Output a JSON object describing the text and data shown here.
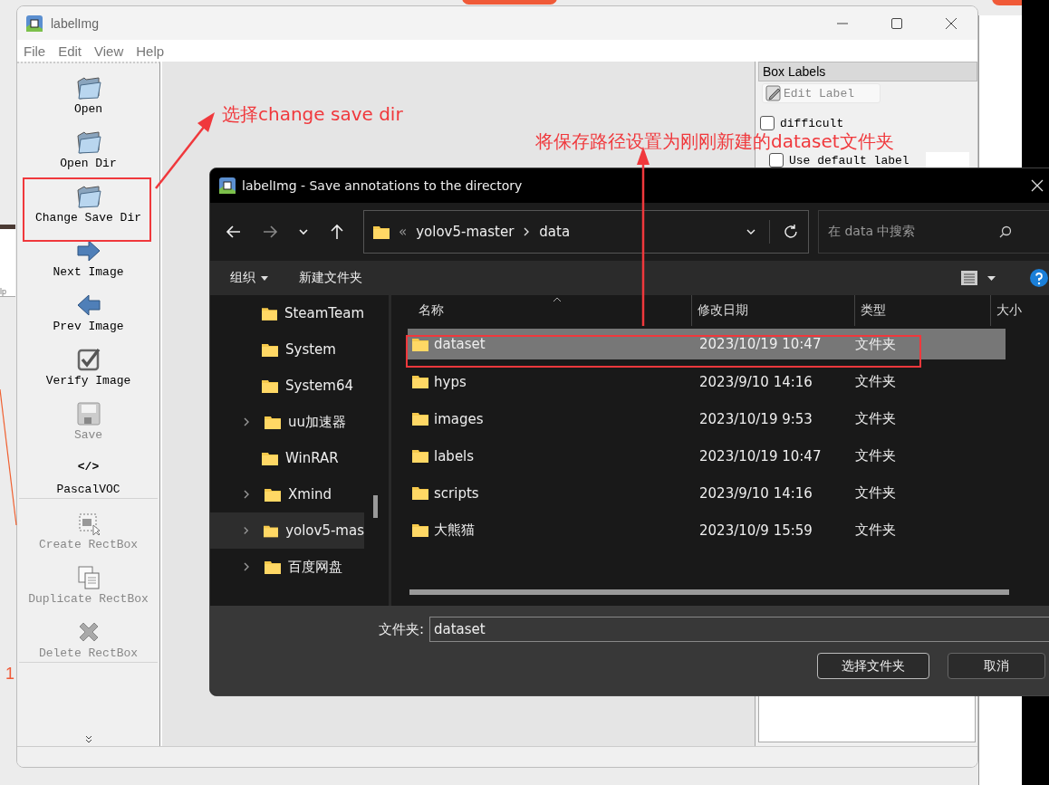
{
  "window": {
    "title": "labelImg"
  },
  "menu": [
    "File",
    "Edit",
    "View",
    "Help"
  ],
  "toolbar_groups": [
    [
      {
        "label": "Open",
        "kind": "folder",
        "disabled": false
      },
      {
        "label": "Open Dir",
        "kind": "folder",
        "disabled": false
      },
      {
        "label": "Change Save Dir",
        "kind": "folder",
        "disabled": false
      },
      {
        "label": "Next Image",
        "kind": "next",
        "disabled": false
      },
      {
        "label": "Prev Image",
        "kind": "prev",
        "disabled": false
      },
      {
        "label": "Verify Image",
        "kind": "verify",
        "disabled": false
      },
      {
        "label": "Save",
        "kind": "save",
        "disabled": true
      },
      {
        "label": "PascalVOC",
        "kind": "glyph",
        "glyph": "</>",
        "disabled": false
      }
    ],
    [
      {
        "label": "Create RectBox",
        "kind": "create",
        "disabled": true
      },
      {
        "label": "Duplicate RectBox",
        "kind": "duplicate",
        "disabled": true
      },
      {
        "label": "Delete RectBox",
        "kind": "delete",
        "disabled": true
      }
    ]
  ],
  "dock": {
    "title": "Box Labels",
    "edit_label": {
      "label": "Edit Label",
      "disabled": true
    },
    "difficult": {
      "label": "difficult",
      "checked": false
    },
    "use_default_label": {
      "label": "Use default label",
      "checked": false
    }
  },
  "dialog": {
    "title": "labelImg - Save annotations to the directory",
    "breadcrumb": {
      "overflow": "«",
      "parts": [
        "yolov5-master",
        "data"
      ]
    },
    "search": {
      "placeholder": "在 data 中搜索"
    },
    "commands": {
      "organize": "组织",
      "new_folder": "新建文件夹"
    },
    "nav_tree": [
      {
        "label": "SteamTeam",
        "expandable": false,
        "selected": false
      },
      {
        "label": "System",
        "expandable": false,
        "selected": false
      },
      {
        "label": "System64",
        "expandable": false,
        "selected": false
      },
      {
        "label": "uu加速器",
        "expandable": true,
        "selected": false
      },
      {
        "label": "WinRAR",
        "expandable": false,
        "selected": false
      },
      {
        "label": "Xmind",
        "expandable": true,
        "selected": false
      },
      {
        "label": "yolov5-mas",
        "expandable": true,
        "selected": true
      },
      {
        "label": "百度网盘",
        "expandable": true,
        "selected": false
      }
    ],
    "columns": [
      "名称",
      "修改日期",
      "类型",
      "大小"
    ],
    "rows": [
      {
        "name": "dataset",
        "modified": "2023/10/19 10:47",
        "type": "文件夹",
        "selected": true
      },
      {
        "name": "hyps",
        "modified": "2023/9/10 14:16",
        "type": "文件夹",
        "selected": false
      },
      {
        "name": "images",
        "modified": "2023/10/19 9:53",
        "type": "文件夹",
        "selected": false
      },
      {
        "name": "labels",
        "modified": "2023/10/19 10:47",
        "type": "文件夹",
        "selected": false
      },
      {
        "name": "scripts",
        "modified": "2023/9/10 14:16",
        "type": "文件夹",
        "selected": false
      },
      {
        "name": "大熊猫",
        "modified": "2023/10/9 15:59",
        "type": "文件夹",
        "selected": false
      }
    ],
    "folder_label": "文件夹:",
    "folder_value": "dataset",
    "buttons": [
      "选择文件夹",
      "取消"
    ]
  },
  "annotations": [
    "选择change save dir",
    "将保存路径设置为刚刚新建的dataset文件夹"
  ],
  "side_note": "1",
  "fragment_text": "lp"
}
